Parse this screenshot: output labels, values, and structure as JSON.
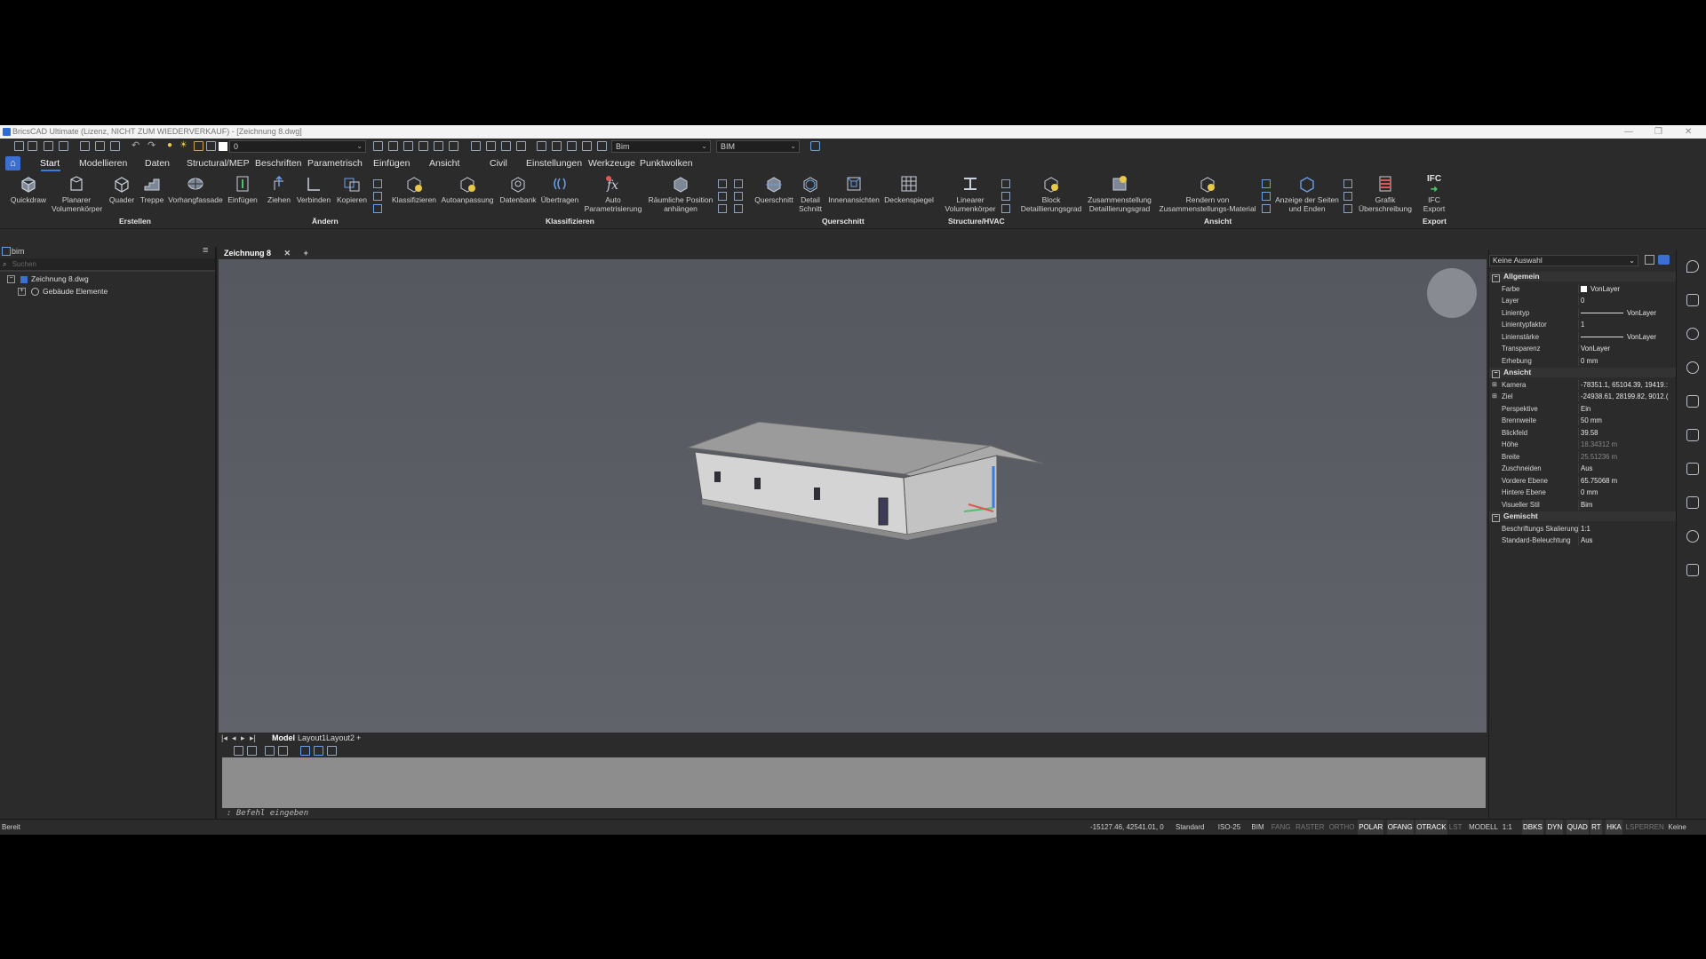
{
  "window": {
    "title": "BricsCAD Ultimate (Lizenz, NICHT ZUM WIEDERVERKAUF) - [Zeichnung 8.dwg]"
  },
  "quick_access": {
    "layer_value": "0",
    "workspace_value": "Bim",
    "profile_value": "BIM"
  },
  "menu": {
    "items": [
      "Start",
      "Modellieren",
      "Daten",
      "Structural/MEP",
      "Beschriften",
      "Parametrisch",
      "Einfügen",
      "Ansicht",
      "Civil",
      "Einstellungen",
      "Werkzeuge",
      "Punktwolken"
    ]
  },
  "ribbon": {
    "buttons": [
      {
        "label": "Quickdraw"
      },
      {
        "label": "Planarer Volumenkörper"
      },
      {
        "label": "Quader"
      },
      {
        "label": "Treppe"
      },
      {
        "label": "Vorhangfassade"
      },
      {
        "label": "Einfügen"
      },
      {
        "label": "Ziehen"
      },
      {
        "label": "Verbinden"
      },
      {
        "label": "Kopieren"
      },
      {
        "label": "Klassifizieren"
      },
      {
        "label": "Autoanpassung"
      },
      {
        "label": "Datenbank"
      },
      {
        "label": "Übertragen"
      },
      {
        "label": "Auto Parametrisierung"
      },
      {
        "label": "Räumliche Position anhängen"
      },
      {
        "label": "Querschnitt"
      },
      {
        "label": "Detail Schnitt"
      },
      {
        "label": "Innenansichten"
      },
      {
        "label": "Deckenspiegel"
      },
      {
        "label": "Linearer Volumenkörper"
      },
      {
        "label": "Block Detaillierungsgrad"
      },
      {
        "label": "Zusammenstellung Detaillierungsgrad"
      },
      {
        "label": "Rendern von Zusammenstellungs-Material"
      },
      {
        "label": "Anzeige der Seiten und Enden"
      },
      {
        "label": "Grafik Überschreibung"
      },
      {
        "label": "IFC Export"
      }
    ],
    "groups": [
      "Erstellen",
      "Ändern",
      "Klassifizieren",
      "Querschnitt",
      "Structure/HVAC",
      "Ansicht",
      "Export"
    ],
    "ifc_tag": "IFC"
  },
  "sidebar": {
    "title": "bim",
    "search_placeholder": "Suchen",
    "tree": [
      {
        "label": "Zeichnung 8.dwg"
      },
      {
        "label": "Gebäude Elemente"
      }
    ]
  },
  "tabs": {
    "active": "Zeichnung 8",
    "add": "+"
  },
  "layouts": {
    "items": [
      "Model",
      "Layout1",
      "Layout2",
      "+"
    ]
  },
  "command": {
    "prompt": ": Befehl eingeben"
  },
  "properties": {
    "selection": "Keine Auswahl",
    "sections": [
      {
        "title": "Allgemein",
        "rows": [
          {
            "key": "Farbe",
            "value": "VonLayer"
          },
          {
            "key": "Layer",
            "value": "0"
          },
          {
            "key": "Linientyp",
            "value": "VonLayer"
          },
          {
            "key": "Linientypfaktor",
            "value": "1"
          },
          {
            "key": "Linienstärke",
            "value": "VonLayer"
          },
          {
            "key": "Transparenz",
            "value": "VonLayer"
          },
          {
            "key": "Erhebung",
            "value": "0 mm"
          }
        ]
      },
      {
        "title": "Ansicht",
        "rows": [
          {
            "key": "Kamera",
            "value": "-78351.1, 65104.39, 19419.:"
          },
          {
            "key": "Ziel",
            "value": "-24938.61, 28199.82, 9012.("
          },
          {
            "key": "Perspektive",
            "value": "Ein"
          },
          {
            "key": "Brennweite",
            "value": "50 mm"
          },
          {
            "key": "Blickfeld",
            "value": "39.58"
          },
          {
            "key": "Höhe",
            "value": "18.34312 m",
            "dim": true
          },
          {
            "key": "Breite",
            "value": "25.51236 m",
            "dim": true
          },
          {
            "key": "Zuschneiden",
            "value": "Aus"
          },
          {
            "key": "Vordere Ebene",
            "value": "65.75068 m"
          },
          {
            "key": "Hintere Ebene",
            "value": "0 mm"
          },
          {
            "key": "Visueller Stil",
            "value": "Bim"
          }
        ]
      },
      {
        "title": "Gemischt",
        "rows": [
          {
            "key": "Beschriftungs Skalierung",
            "value": "1:1"
          },
          {
            "key": "Standard-Beleuchtung",
            "value": "Aus"
          }
        ]
      }
    ]
  },
  "status": {
    "left": "Bereit",
    "coords": "-15127.46, 42541.01, 0",
    "items": [
      {
        "label": "Standard",
        "state": "normal"
      },
      {
        "label": "ISO-25",
        "state": "normal"
      },
      {
        "label": "BIM",
        "state": "normal"
      },
      {
        "label": "FANG",
        "state": "off"
      },
      {
        "label": "RASTER",
        "state": "off"
      },
      {
        "label": "ORTHO",
        "state": "off"
      },
      {
        "label": "POLAR",
        "state": "on"
      },
      {
        "label": "OFANG",
        "state": "on"
      },
      {
        "label": "OTRACK",
        "state": "on"
      },
      {
        "label": "LST",
        "state": "off"
      },
      {
        "label": "MODELL",
        "state": "normal"
      },
      {
        "label": "1:1",
        "state": "normal"
      },
      {
        "label": "DBKS",
        "state": "on"
      },
      {
        "label": "DYN",
        "state": "on"
      },
      {
        "label": "QUAD",
        "state": "on"
      },
      {
        "label": "RT",
        "state": "on"
      },
      {
        "label": "HKA",
        "state": "on"
      },
      {
        "label": "LSPERREN",
        "state": "off"
      },
      {
        "label": "Keine",
        "state": "normal"
      }
    ]
  },
  "colors": {
    "accent": "#3b6fd1",
    "viewport": "#5b5e65",
    "panel": "#2b2b2b"
  }
}
